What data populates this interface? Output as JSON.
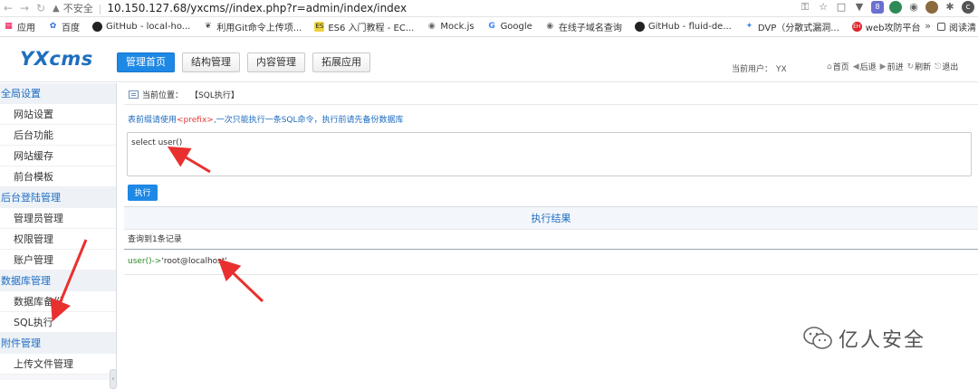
{
  "browser": {
    "insecure_label": "不安全",
    "url": "10.150.127.68/yxcms//index.php?r=admin/index/index",
    "bookmarks": [
      {
        "label": "应用",
        "icon": "apps-grid-icon"
      },
      {
        "label": "百度",
        "icon": "baidu-paw-icon"
      },
      {
        "label": "GitHub - local-ho...",
        "icon": "github-icon"
      },
      {
        "label": "利用Git命令上传项...",
        "icon": "git-icon"
      },
      {
        "label": "ES6 入门教程 - EC...",
        "icon": "es6-icon"
      },
      {
        "label": "Mock.js",
        "icon": "globe-icon"
      },
      {
        "label": "Google",
        "icon": "google-icon"
      },
      {
        "label": "在线子域名查询",
        "icon": "globe-icon"
      },
      {
        "label": "GitHub - fluid-de...",
        "icon": "github-icon"
      },
      {
        "label": "DVP（分散式漏洞...",
        "icon": "dvp-icon"
      },
      {
        "label": "web攻防平台",
        "icon": "web-attack-icon"
      }
    ],
    "more_label": "»",
    "reading_list_label": "阅读清"
  },
  "header": {
    "logo": "YXcms",
    "tabs": [
      {
        "label": "管理首页",
        "active": true
      },
      {
        "label": "结构管理",
        "active": false
      },
      {
        "label": "内容管理",
        "active": false
      },
      {
        "label": "拓展应用",
        "active": false
      }
    ],
    "current_user_label": "当前用户：",
    "current_user": "YX",
    "links": [
      {
        "label": "首页",
        "icon": "home-icon"
      },
      {
        "label": "后退",
        "icon": "back-icon"
      },
      {
        "label": "前进",
        "icon": "forward-icon"
      },
      {
        "label": "刷新",
        "icon": "refresh-icon"
      },
      {
        "label": "退出",
        "icon": "logout-icon"
      }
    ]
  },
  "sidebar": {
    "groups": [
      {
        "title": "全局设置",
        "items": [
          "网站设置",
          "后台功能",
          "网站缓存",
          "前台模板"
        ]
      },
      {
        "title": "后台登陆管理",
        "items": [
          "管理员管理",
          "权限管理",
          "账户管理"
        ]
      },
      {
        "title": "数据库管理",
        "items": [
          "数据库备份",
          "SQL执行"
        ]
      },
      {
        "title": "附件管理",
        "items": [
          "上传文件管理"
        ]
      }
    ]
  },
  "main": {
    "breadcrumb_label": "当前位置：",
    "breadcrumb_current": "【SQL执行】",
    "notice_prefix": "表前缀请使用",
    "notice_token": "<prefix>",
    "notice_suffix": ",一次只能执行一条SQL命令，执行前请先备份数据库",
    "sql_value": "select user()",
    "execute_label": "执行",
    "result_title": "执行结果",
    "result_count": "查询到1条记录",
    "result_key": "user()",
    "result_arrow": "->",
    "result_value": "'root@localhost'"
  },
  "watermark": {
    "text": "亿人安全",
    "icon": "wechat-icon"
  },
  "colors": {
    "accent": "#1e88e5",
    "link": "#1e6cc0",
    "arrow": "#e8312f",
    "result_green": "#2e8b2e"
  }
}
